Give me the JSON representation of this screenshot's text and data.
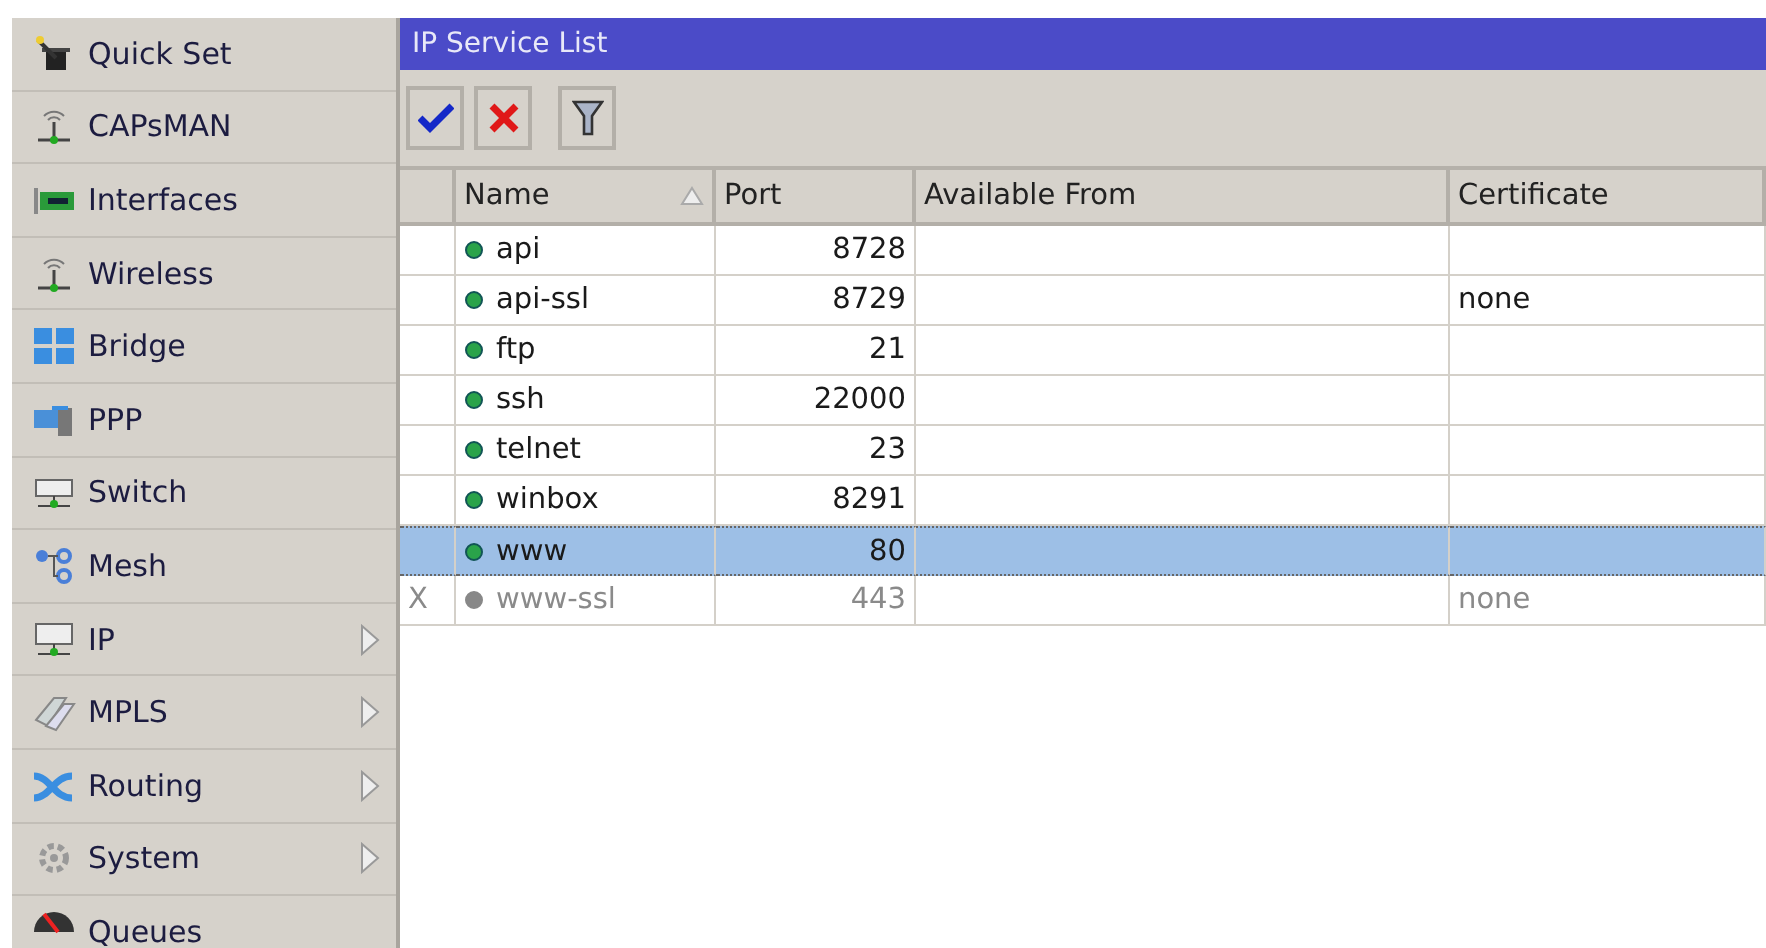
{
  "sidebar": {
    "items": [
      {
        "label": "Quick Set",
        "has_submenu": false
      },
      {
        "label": "CAPsMAN",
        "has_submenu": false
      },
      {
        "label": "Interfaces",
        "has_submenu": false
      },
      {
        "label": "Wireless",
        "has_submenu": false
      },
      {
        "label": "Bridge",
        "has_submenu": false
      },
      {
        "label": "PPP",
        "has_submenu": false
      },
      {
        "label": "Switch",
        "has_submenu": false
      },
      {
        "label": "Mesh",
        "has_submenu": false
      },
      {
        "label": "IP",
        "has_submenu": true
      },
      {
        "label": "MPLS",
        "has_submenu": true
      },
      {
        "label": "Routing",
        "has_submenu": true
      },
      {
        "label": "System",
        "has_submenu": true
      },
      {
        "label": "Queues",
        "has_submenu": false
      }
    ]
  },
  "window": {
    "title": "IP Service List"
  },
  "table": {
    "columns": [
      {
        "label": "Name",
        "sorted": true
      },
      {
        "label": "Port",
        "sorted": false
      },
      {
        "label": "Available From",
        "sorted": false
      },
      {
        "label": "Certificate",
        "sorted": false
      }
    ],
    "rows": [
      {
        "flag": "",
        "name": "api",
        "port": "8728",
        "available_from": "",
        "certificate": "",
        "disabled": false,
        "selected": false
      },
      {
        "flag": "",
        "name": "api-ssl",
        "port": "8729",
        "available_from": "",
        "certificate": "none",
        "disabled": false,
        "selected": false
      },
      {
        "flag": "",
        "name": "ftp",
        "port": "21",
        "available_from": "",
        "certificate": "",
        "disabled": false,
        "selected": false
      },
      {
        "flag": "",
        "name": "ssh",
        "port": "22000",
        "available_from": "",
        "certificate": "",
        "disabled": false,
        "selected": false
      },
      {
        "flag": "",
        "name": "telnet",
        "port": "23",
        "available_from": "",
        "certificate": "",
        "disabled": false,
        "selected": false
      },
      {
        "flag": "",
        "name": "winbox",
        "port": "8291",
        "available_from": "",
        "certificate": "",
        "disabled": false,
        "selected": false
      },
      {
        "flag": "",
        "name": "www",
        "port": "80",
        "available_from": "",
        "certificate": "",
        "disabled": false,
        "selected": true
      },
      {
        "flag": "X",
        "name": "www-ssl",
        "port": "443",
        "available_from": "",
        "certificate": "none",
        "disabled": true,
        "selected": false
      }
    ]
  }
}
